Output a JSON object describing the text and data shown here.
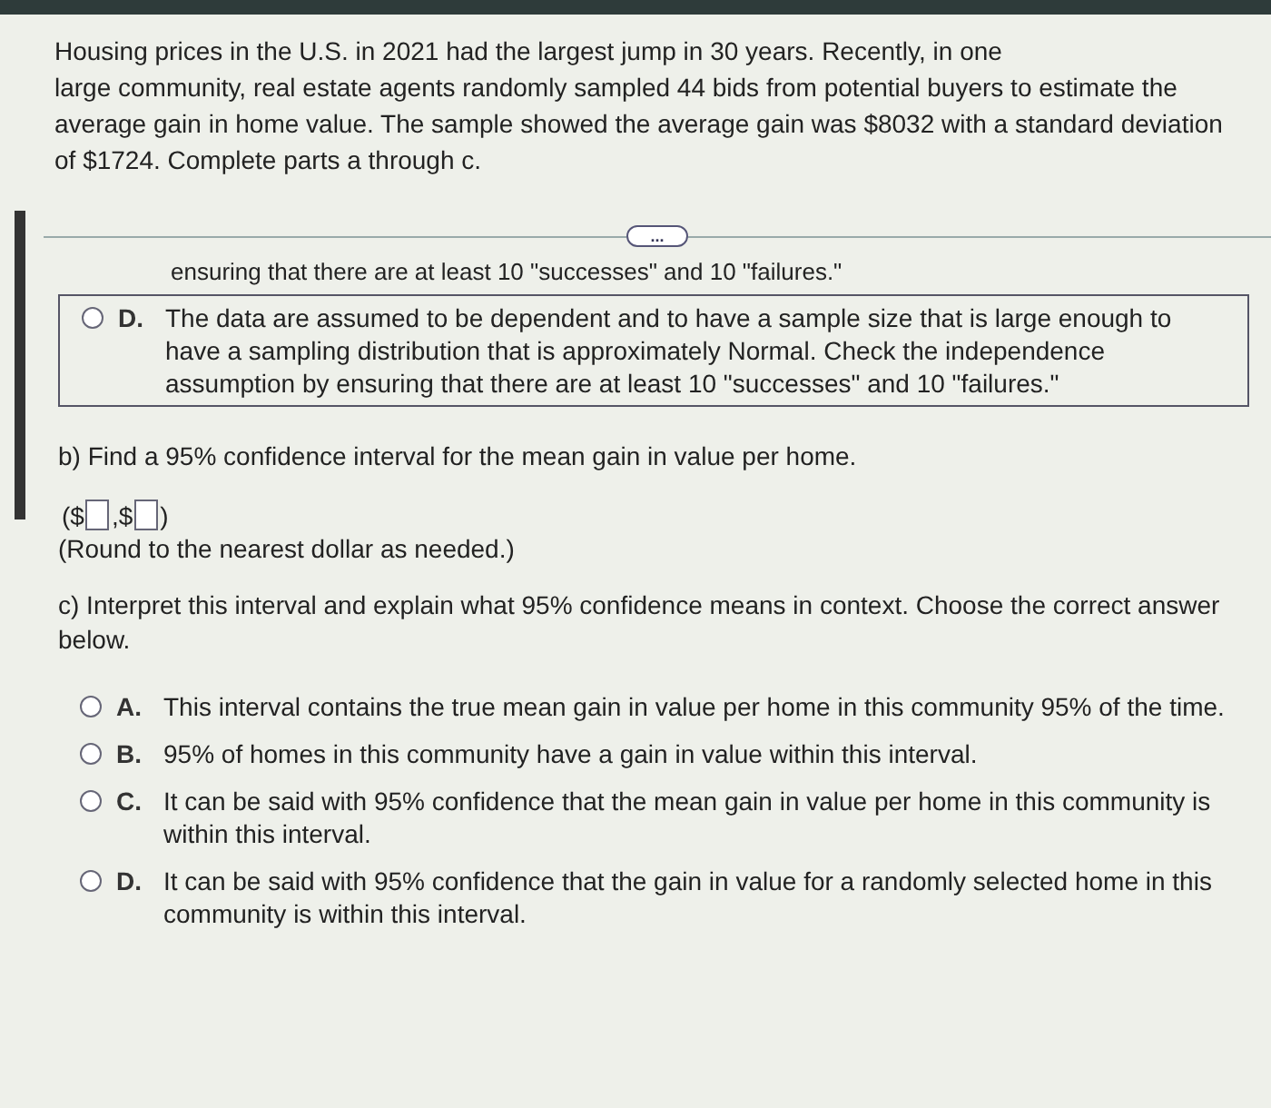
{
  "intro": [
    "Housing prices in the U.S. in 2021 had the largest jump in 30 years. Recently, in one",
    "large community, real estate agents randomly sampled 44 bids from potential buyers to estimate the average gain in home value. The sample showed the average gain was $8032 with a standard deviation of $1724. Complete parts a through c."
  ],
  "expand_button": "...",
  "part_a": {
    "cut_line": "ensuring that there are at least 10 \"successes\" and 10 \"failures.\"",
    "options": [
      {
        "letter": "D.",
        "text": "The data are assumed to be dependent and to have a sample size that is large enough to have a sampling distribution that is approximately Normal. Check the independence assumption by ensuring that there are at least 10 \"successes\" and 10 \"failures.\"",
        "selected": false,
        "highlighted": true
      }
    ]
  },
  "part_b": {
    "question": "b) Find a 95% confidence interval for the mean gain in value per home.",
    "open": "($",
    "separator": ",$",
    "close": ")",
    "inputs": [
      {
        "kind": "box"
      },
      {
        "kind": "box"
      }
    ],
    "note": "(Round to the nearest dollar as needed.)"
  },
  "part_c": {
    "question": "c) Interpret this interval and explain what 95% confidence means in context. Choose the correct answer below.",
    "options": [
      {
        "letter": "A.",
        "text": "This interval contains the true mean gain in value per home in this community 95% of the time.",
        "selected": false,
        "highlighted": false
      },
      {
        "letter": "B.",
        "text": "95% of homes in this community have a gain in value within this interval.",
        "selected": false,
        "highlighted": false
      },
      {
        "letter": "C.",
        "text": "It can be said with 95% confidence that the mean gain in value per home in this community is within this interval.",
        "selected": false,
        "highlighted": false
      },
      {
        "letter": "D.",
        "text": "It can be said with 95% confidence that the gain in value for a randomly selected home in this community is within this interval.",
        "selected": false,
        "highlighted": false
      }
    ]
  }
}
